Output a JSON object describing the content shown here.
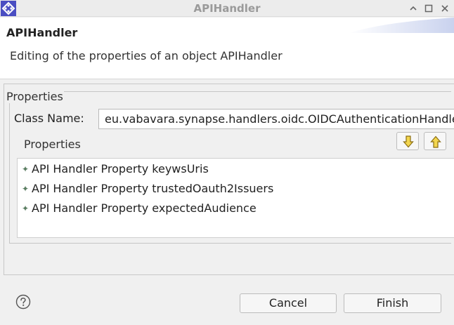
{
  "window": {
    "title": "APIHandler"
  },
  "header": {
    "title": "APIHandler",
    "description": "Editing of the properties of an object APIHandler"
  },
  "group": {
    "label": "Properties",
    "class_name_label": "Class Name:",
    "class_name_value": "eu.vabavara.synapse.handlers.oidc.OIDCAuthenticationHandler",
    "properties_label": "Properties",
    "items": [
      {
        "label": "API Handler Property keywsUris"
      },
      {
        "label": "API Handler Property trustedOauth2Issuers"
      },
      {
        "label": "API Handler Property expectedAudience"
      }
    ]
  },
  "footer": {
    "cancel_label": "Cancel",
    "finish_label": "Finish"
  },
  "icons": {
    "app": "app-icon",
    "minimize": "minimize-icon",
    "maximize": "maximize-icon",
    "close": "close-icon",
    "move_down": "arrow-down-icon",
    "move_up": "arrow-up-icon",
    "help": "help-icon",
    "bullet": "property-bullet-icon"
  },
  "colors": {
    "accent_blue": "#4a4ec2",
    "arrow_yellow": "#f3d64e",
    "bullet_green": "#5a7d61"
  }
}
